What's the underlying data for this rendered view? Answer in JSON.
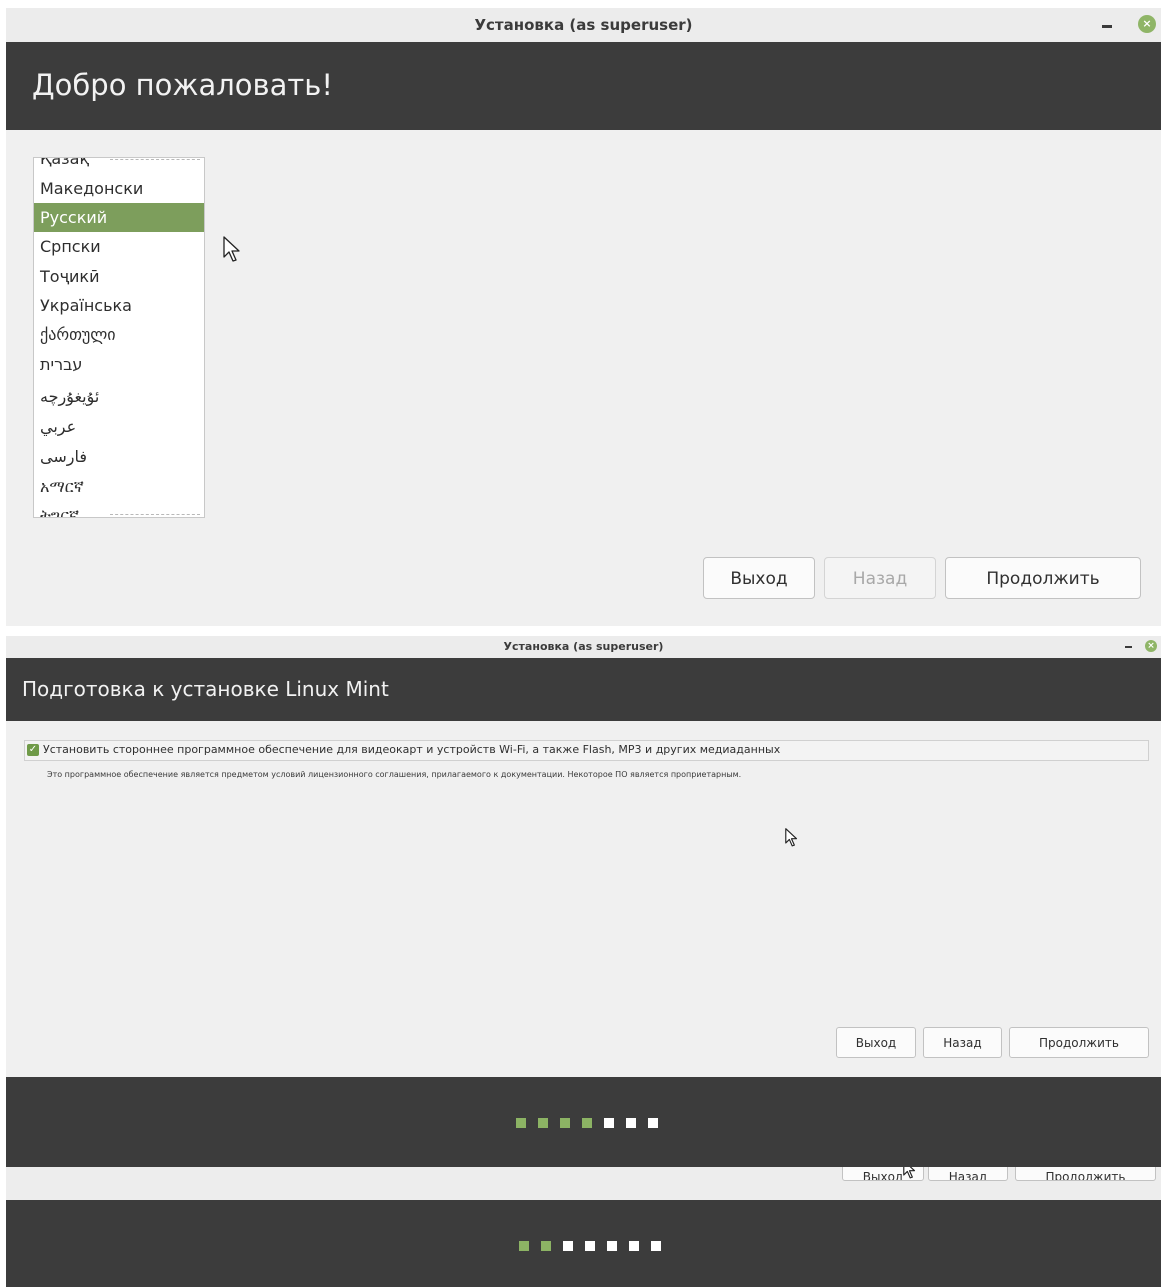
{
  "colors": {
    "accent_green": "#7d9e5c",
    "header_dark": "#3c3c3c",
    "dot_active": "#8cb364",
    "dot_inactive": "#ffffff"
  },
  "window1": {
    "title": "Установка (as superuser)",
    "heading": "Добро пожаловать!",
    "languages": [
      "Қазақ",
      "Македонски",
      "Русский",
      "Српски",
      "Тоҷикӣ",
      "Українська",
      "ქართული",
      "עברית",
      "ئۇيغۇرچە",
      "عربي",
      "فارسی",
      "አማርኛ",
      "ትግርኛ"
    ],
    "selected_language": "Русский",
    "buttons": {
      "quit": "Выход",
      "back": "Назад",
      "continue": "Продолжить"
    }
  },
  "window2": {
    "title": "Установка (as superuser)",
    "heading": "Подготовка к установке Linux Mint",
    "codecs_label": "Установить стороннее программное обеспечение для видеокарт и устройств Wi-Fi, а также Flash, MP3 и других медиаданных",
    "codecs_checked": true,
    "codecs_note": "Это программное обеспечение является предметом условий лицензионного соглашения, прилагаемого к документации. Некоторое ПО является проприетарным.",
    "buttons": {
      "quit": "Выход",
      "back": "Назад",
      "continue": "Продолжить"
    }
  },
  "progress": {
    "total_steps": 7,
    "steps_done_window2": 4,
    "steps_done_window1": 2
  },
  "peek_buttons": {
    "quit": "Выход",
    "back": "Назад",
    "continue": "Продолжить"
  }
}
